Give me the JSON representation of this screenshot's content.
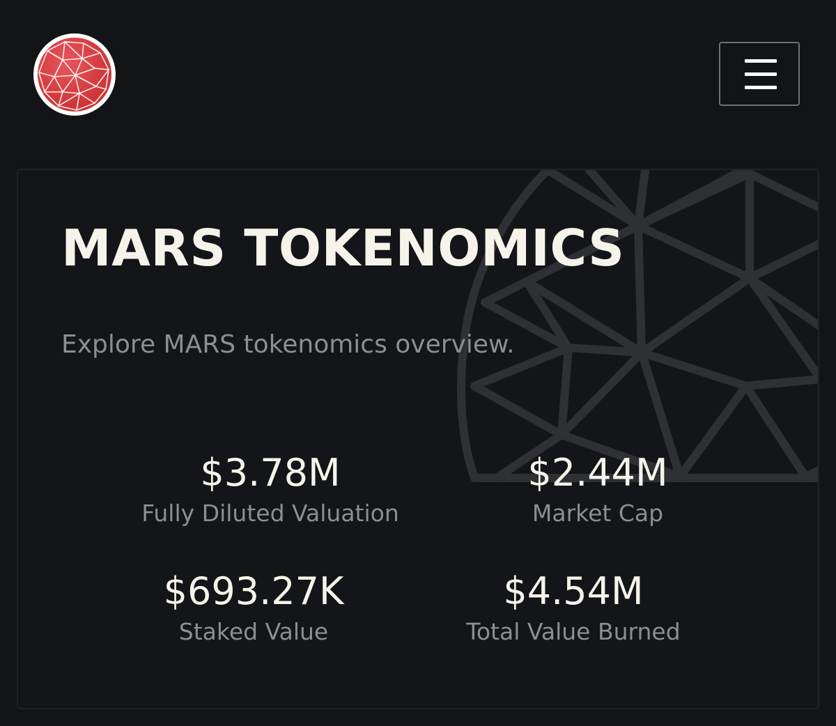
{
  "header": {
    "logo_icon": "mars-globe-logo",
    "menu_icon": "hamburger-menu-icon",
    "logo_color": "#e0454a"
  },
  "overview": {
    "title": "MARS TOKENOMICS",
    "subtitle": "Explore MARS tokenomics overview.",
    "background_icon": "geodesic-globe-graphic",
    "stats": [
      {
        "value": "$3.78M",
        "label": "Fully Diluted Valuation"
      },
      {
        "value": "$2.44M",
        "label": "Market Cap"
      },
      {
        "value": "$693.27K",
        "label": "Staked Value"
      },
      {
        "value": "$4.54M",
        "label": "Total Value Burned"
      }
    ]
  }
}
